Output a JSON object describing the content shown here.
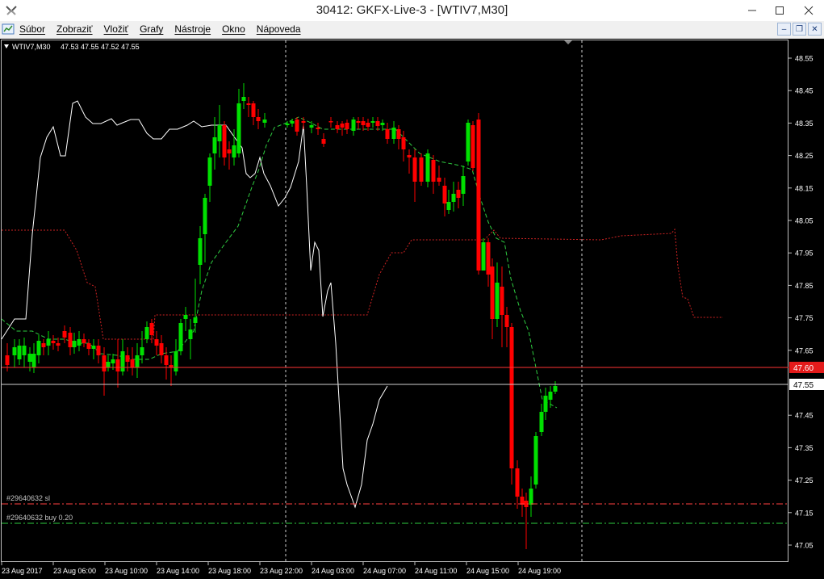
{
  "window": {
    "title": "30412: GKFX-Live-3 - [WTIV7,M30]"
  },
  "menu": {
    "items": [
      "Súbor",
      "Zobraziť",
      "Vložiť",
      "Grafy",
      "Nástroje",
      "Okno",
      "Nápoveda"
    ]
  },
  "chart": {
    "symbol_label": "WTIV7,M30",
    "ohlc_text": "47.53 47.55 47.52 47.55",
    "price_labels": [
      "48.55",
      "48.45",
      "48.35",
      "48.25",
      "48.15",
      "48.05",
      "47.95",
      "47.85",
      "47.75",
      "47.65",
      "47.45",
      "47.35",
      "47.25",
      "47.15",
      "47.05"
    ],
    "time_labels": [
      "23 Aug 2017",
      "23 Aug 06:00",
      "23 Aug 10:00",
      "23 Aug 14:00",
      "23 Aug 18:00",
      "23 Aug 22:00",
      "24 Aug 03:00",
      "24 Aug 07:00",
      "24 Aug 11:00",
      "24 Aug 15:00",
      "24 Aug 19:00"
    ],
    "current_price": "47.55",
    "red_level_price": "47.60",
    "order_sl_label": "#29640632 sl",
    "order_buy_label": "#29640632 buy 0.20",
    "colors": {
      "bull": "#00e000",
      "bear": "#ff0000",
      "background": "#000000",
      "axis_text": "#ffffff"
    }
  }
}
